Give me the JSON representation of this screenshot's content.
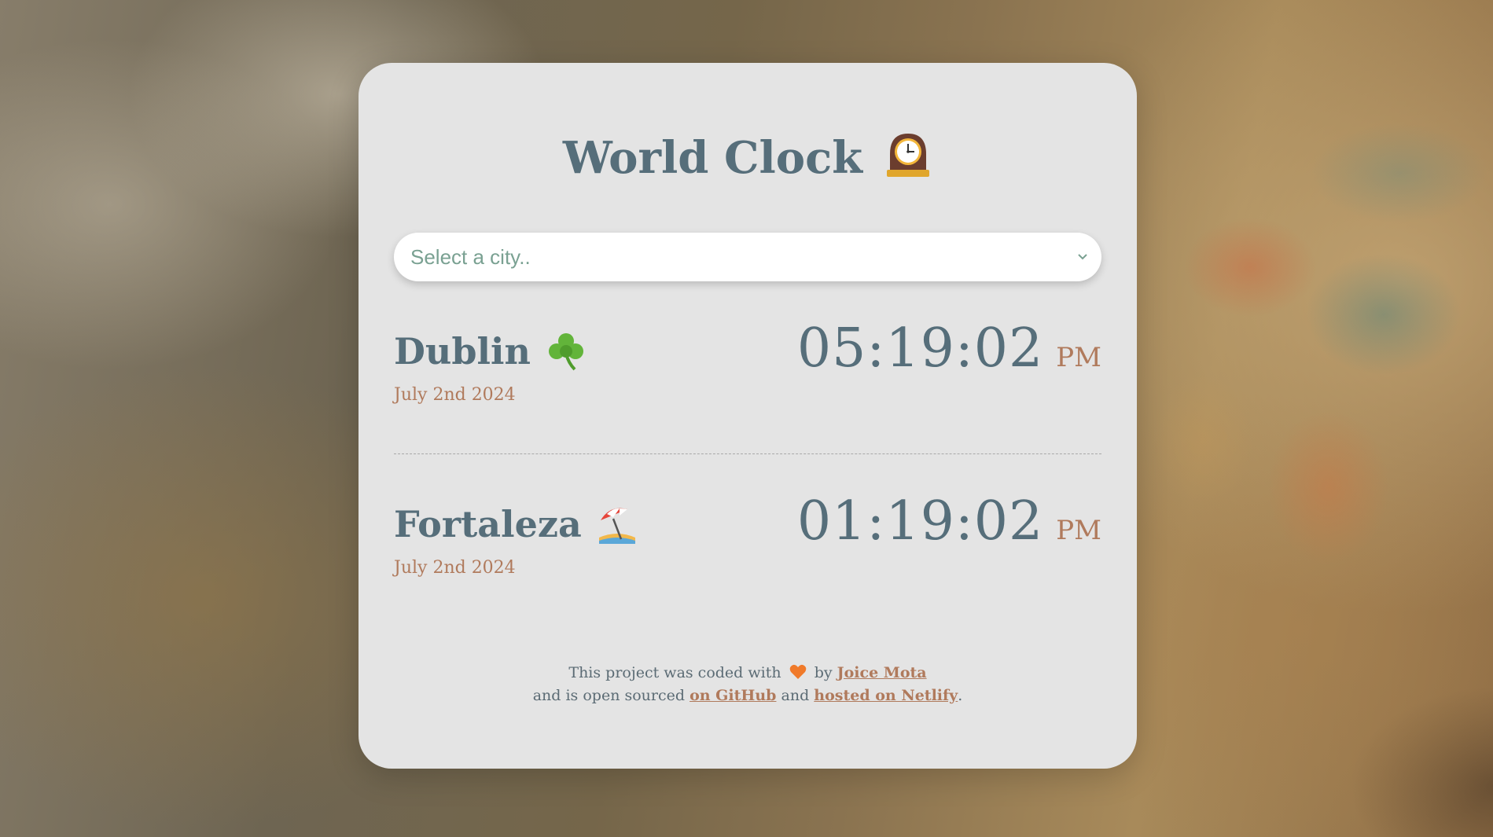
{
  "app": {
    "title": "World Clock",
    "title_icon": "mantelpiece-clock-icon"
  },
  "search": {
    "placeholder": "Select a city..",
    "icon": "chevron-down-icon"
  },
  "cities": [
    {
      "name": "Dublin",
      "icon": "shamrock-icon",
      "date": "July 2nd 2024",
      "time": "05:19:02",
      "ampm": "PM"
    },
    {
      "name": "Fortaleza",
      "icon": "beach-umbrella-icon",
      "date": "July 2nd 2024",
      "time": "01:19:02",
      "ampm": "PM"
    }
  ],
  "footer": {
    "line1_prefix": "This project was coded with",
    "heart_icon": "orange-heart-icon",
    "line1_by": "by",
    "author_link": "Joice Mota",
    "line2_prefix": "and is open sourced",
    "github_link": "on GitHub",
    "and": "and",
    "netlify_link": "hosted on Netlify",
    "period": "."
  },
  "colors": {
    "card_background": "#e4e4e4",
    "primary_text": "#566e7a",
    "accent_text": "#b07a5c",
    "placeholder_text": "#7aa192"
  }
}
